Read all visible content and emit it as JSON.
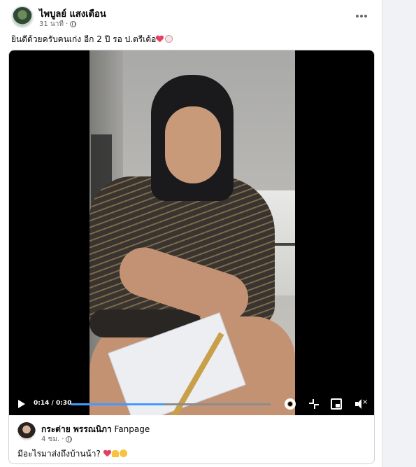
{
  "post": {
    "author": "ไพบูลย์ แสงเดือน",
    "time": "31 นาที ·",
    "caption": "ยินดีด้วยครับคนเก่ง อีก 2 ปี รอ ป.ตรีเด้อ",
    "more_icon": "more-horizontal-icon"
  },
  "video": {
    "time_display": "0:14 / 0:30",
    "progress": 0.467,
    "icons": [
      "play-icon",
      "gear-icon",
      "fullscreen-icon",
      "picture-in-picture-icon",
      "mute-icon"
    ]
  },
  "shared_post": {
    "author": "กระต่าย พรรณนิภา",
    "page_tag": "Fanpage",
    "time": "4 ชม. ·",
    "caption": "มีอะไรมาส่งถึงบ้านน้า?"
  },
  "colors": {
    "accent": "#4599ff",
    "text_primary": "#050505",
    "text_secondary": "#65676b"
  }
}
